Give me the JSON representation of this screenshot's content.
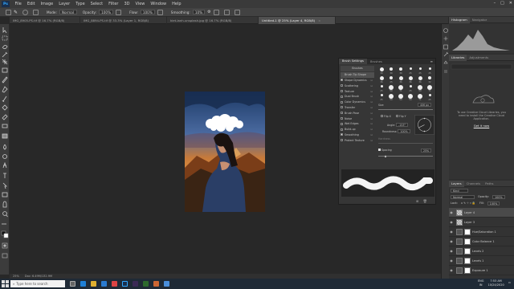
{
  "menubar": {
    "logo": "Ps",
    "items": [
      "File",
      "Edit",
      "Image",
      "Layer",
      "Type",
      "Select",
      "Filter",
      "3D",
      "View",
      "Window",
      "Help"
    ]
  },
  "options": {
    "mode_label": "Mode:",
    "mode_value": "Normal",
    "opacity_label": "Opacity:",
    "opacity_value": "100%",
    "flow_label": "Flow:",
    "flow_value": "100%",
    "smoothing_label": "Smoothing:",
    "smoothing_value": "10%"
  },
  "tabs": [
    {
      "label": "IMG_8905-PS.tif @ 16.7% (RGB/8)",
      "active": false
    },
    {
      "label": "IMG_8894-PS.tif @ 33.3% (Layer 1, RGB/8)",
      "active": false
    },
    {
      "label": "kiet-lanh-unsplash.jpg @ 16.7% (RGB/8)",
      "active": false
    },
    {
      "label": "Untitled-1 @ 25% (Layer 4, RGB/8)",
      "active": true
    }
  ],
  "statusbar": {
    "zoom": "25%",
    "doc": "Doc: 6.49M/132.9M"
  },
  "histogram": {
    "tabs": [
      "Histogram",
      "Navigator"
    ]
  },
  "libraries": {
    "tabs": [
      "Libraries",
      "Adjustments"
    ],
    "message": "To use Creative Cloud Libraries, you need to install the Creative Cloud Application.",
    "link": "Get it now"
  },
  "layers": {
    "tabs": [
      "Layers",
      "Channels",
      "Paths"
    ],
    "kind": "Kind",
    "blend": "Normal",
    "opacity_label": "Opacity:",
    "opacity": "100%",
    "lock_label": "Lock:",
    "fill_label": "Fill:",
    "fill": "100%",
    "rows": [
      {
        "name": "Layer 4",
        "selected": true
      },
      {
        "name": "Layer 3",
        "selected": false
      },
      {
        "name": "Hue/Saturation 1",
        "selected": false
      },
      {
        "name": "Color Balance 1",
        "selected": false
      },
      {
        "name": "Levels 2",
        "selected": false
      },
      {
        "name": "Levels 1",
        "selected": false
      },
      {
        "name": "Exposure 1",
        "selected": false
      }
    ]
  },
  "brush_panel": {
    "tabs": [
      "Brush Settings",
      "Brushes"
    ],
    "brushes_button": "Brushes",
    "options": [
      {
        "label": "Brush Tip Shape",
        "checked": false,
        "active": true
      },
      {
        "label": "Shape Dynamics",
        "checked": true,
        "active": false
      },
      {
        "label": "Scattering",
        "checked": false,
        "active": false
      },
      {
        "label": "Texture",
        "checked": false,
        "active": false
      },
      {
        "label": "Dual Brush",
        "checked": false,
        "active": false
      },
      {
        "label": "Color Dynamics",
        "checked": false,
        "active": false
      },
      {
        "label": "Transfer",
        "checked": false,
        "active": false
      },
      {
        "label": "Brush Pose",
        "checked": false,
        "active": false
      },
      {
        "label": "Noise",
        "checked": false,
        "active": false
      },
      {
        "label": "Wet Edges",
        "checked": false,
        "active": false
      },
      {
        "label": "Build-up",
        "checked": false,
        "active": false
      },
      {
        "label": "Smoothing",
        "checked": true,
        "active": false
      },
      {
        "label": "Protect Texture",
        "checked": false,
        "active": false
      }
    ],
    "tip_numbers": [
      "30",
      "30",
      "30",
      "25",
      "25",
      "25",
      "36",
      "25",
      "36",
      "36",
      "36",
      "32",
      "25",
      "50",
      "71",
      "25",
      "50",
      "71",
      "25",
      "50",
      "50",
      "50",
      "71",
      "25"
    ],
    "size_label": "Size",
    "size_value": "406 px",
    "flip_x": "Flip X",
    "flip_y": "Flip Y",
    "angle_label": "Angle:",
    "angle_value": "-153°",
    "roundness_label": "Roundness:",
    "roundness_value": "100%",
    "hardness_label": "Hardness",
    "spacing_label": "Spacing",
    "spacing_value": "25%"
  },
  "taskbar": {
    "search_placeholder": "Type here to search",
    "lang": "ENG",
    "region": "IN",
    "time": "7:53 AM",
    "date": "10/24/2020"
  }
}
